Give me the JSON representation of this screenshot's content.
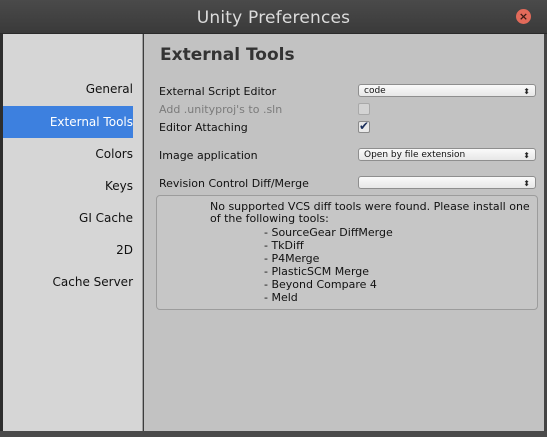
{
  "window": {
    "title": "Unity Preferences",
    "close_symbol": "×"
  },
  "sidebar": {
    "items": [
      {
        "label": "General"
      },
      {
        "label": "External Tools",
        "selected": true
      },
      {
        "label": "Colors"
      },
      {
        "label": "Keys"
      },
      {
        "label": "GI Cache"
      },
      {
        "label": "2D"
      },
      {
        "label": "Cache Server"
      }
    ]
  },
  "main": {
    "heading": "External Tools",
    "script_editor": {
      "label": "External Script Editor",
      "value": "code"
    },
    "unityproj": {
      "label": "Add .unityproj's to .sln",
      "checked": false,
      "enabled": false
    },
    "editor_attaching": {
      "label": "Editor Attaching",
      "checked": true
    },
    "image_app": {
      "label": "Image application",
      "value": "Open by file extension"
    },
    "revision_control": {
      "label": "Revision Control Diff/Merge",
      "value": ""
    },
    "help": {
      "line1": "No supported VCS diff tools were found. Please install one",
      "line2": "of the following tools:",
      "tools": [
        "- SourceGear DiffMerge",
        "- TkDiff",
        "- P4Merge",
        "- PlasticSCM Merge",
        "- Beyond Compare 4",
        "- Meld"
      ]
    }
  },
  "icons": {
    "dropdown": "updown-arrows-icon",
    "check": "checkmark-icon",
    "close": "close-icon"
  },
  "colors": {
    "selection": "#3d80df",
    "titlebar": "#3f3f3f",
    "close": "#e26a5a"
  }
}
